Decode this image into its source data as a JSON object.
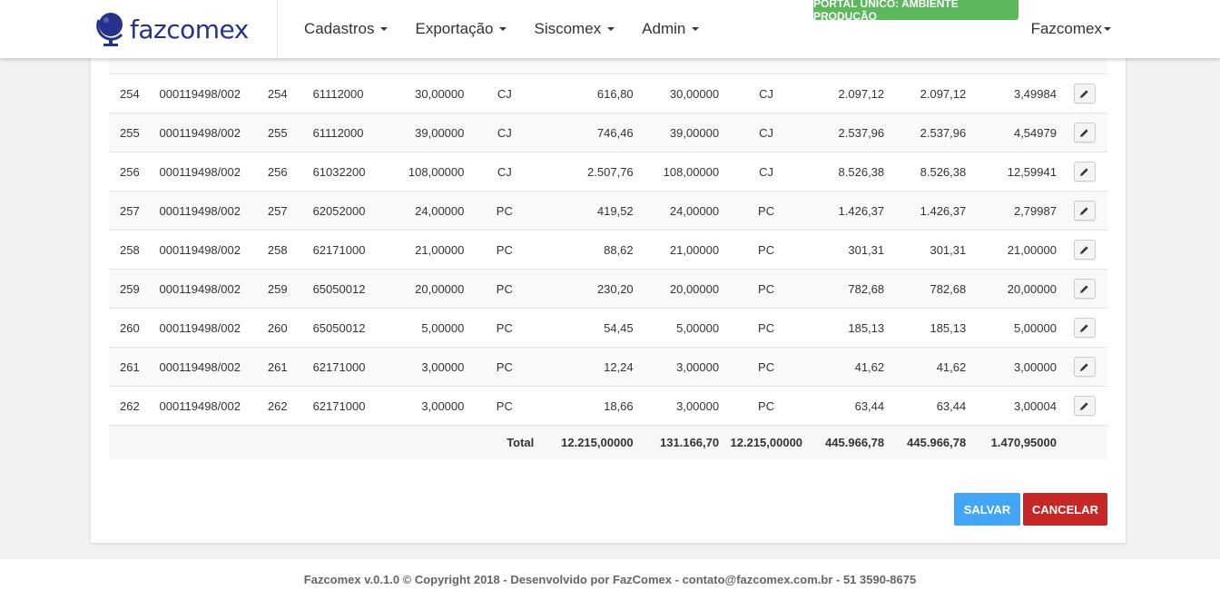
{
  "navbar": {
    "logo_text": "fazcomex",
    "menu": [
      {
        "label": "Cadastros"
      },
      {
        "label": "Exportação"
      },
      {
        "label": "Siscomex"
      },
      {
        "label": "Admin"
      }
    ],
    "env_badge": "PORTAL ÚNICO: AMBIENTE PRODUÇÃO",
    "user": "Fazcomex"
  },
  "table": {
    "rows": [
      {
        "seq": "254",
        "re": "000119498/002",
        "item": "254",
        "ncm": "61112000",
        "qty": "30,00000",
        "unit": "CJ",
        "value": "616,80",
        "qty2": "30,00000",
        "unit2": "CJ",
        "v1": "2.097,12",
        "v2": "2.097,12",
        "peso": "3,49984"
      },
      {
        "seq": "255",
        "re": "000119498/002",
        "item": "255",
        "ncm": "61112000",
        "qty": "39,00000",
        "unit": "CJ",
        "value": "746,46",
        "qty2": "39,00000",
        "unit2": "CJ",
        "v1": "2.537,96",
        "v2": "2.537,96",
        "peso": "4,54979"
      },
      {
        "seq": "256",
        "re": "000119498/002",
        "item": "256",
        "ncm": "61032200",
        "qty": "108,00000",
        "unit": "CJ",
        "value": "2.507,76",
        "qty2": "108,00000",
        "unit2": "CJ",
        "v1": "8.526,38",
        "v2": "8.526,38",
        "peso": "12,59941"
      },
      {
        "seq": "257",
        "re": "000119498/002",
        "item": "257",
        "ncm": "62052000",
        "qty": "24,00000",
        "unit": "PC",
        "value": "419,52",
        "qty2": "24,00000",
        "unit2": "PC",
        "v1": "1.426,37",
        "v2": "1.426,37",
        "peso": "2,79987"
      },
      {
        "seq": "258",
        "re": "000119498/002",
        "item": "258",
        "ncm": "62171000",
        "qty": "21,00000",
        "unit": "PC",
        "value": "88,62",
        "qty2": "21,00000",
        "unit2": "PC",
        "v1": "301,31",
        "v2": "301,31",
        "peso": "21,00000"
      },
      {
        "seq": "259",
        "re": "000119498/002",
        "item": "259",
        "ncm": "65050012",
        "qty": "20,00000",
        "unit": "PC",
        "value": "230,20",
        "qty2": "20,00000",
        "unit2": "PC",
        "v1": "782,68",
        "v2": "782,68",
        "peso": "20,00000"
      },
      {
        "seq": "260",
        "re": "000119498/002",
        "item": "260",
        "ncm": "65050012",
        "qty": "5,00000",
        "unit": "PC",
        "value": "54,45",
        "qty2": "5,00000",
        "unit2": "PC",
        "v1": "185,13",
        "v2": "185,13",
        "peso": "5,00000"
      },
      {
        "seq": "261",
        "re": "000119498/002",
        "item": "261",
        "ncm": "62171000",
        "qty": "3,00000",
        "unit": "PC",
        "value": "12,24",
        "qty2": "3,00000",
        "unit2": "PC",
        "v1": "41,62",
        "v2": "41,62",
        "peso": "3,00000"
      },
      {
        "seq": "262",
        "re": "000119498/002",
        "item": "262",
        "ncm": "62171000",
        "qty": "3,00000",
        "unit": "PC",
        "value": "18,66",
        "qty2": "3,00000",
        "unit2": "PC",
        "v1": "63,44",
        "v2": "63,44",
        "peso": "3,00004"
      }
    ],
    "total": {
      "label": "Total",
      "value": "12.215,00000",
      "qty2": "131.166,70",
      "unit2": "12.215,00000",
      "v1": "445.966,78",
      "v2": "445.966,78",
      "peso": "1.470,95000"
    }
  },
  "actions": {
    "save_label": "SALVAR",
    "cancel_label": "CANCELAR"
  },
  "footer": {
    "text": "Fazcomex v.0.1.0 © Copyright 2018 - Desenvolvido por FazComex - contato@fazcomex.com.br - 51 3590-8675"
  },
  "colors": {
    "brand": "#27328a",
    "badge": "#5cb85c",
    "save": "#42a5f5",
    "cancel": "#c62828"
  }
}
